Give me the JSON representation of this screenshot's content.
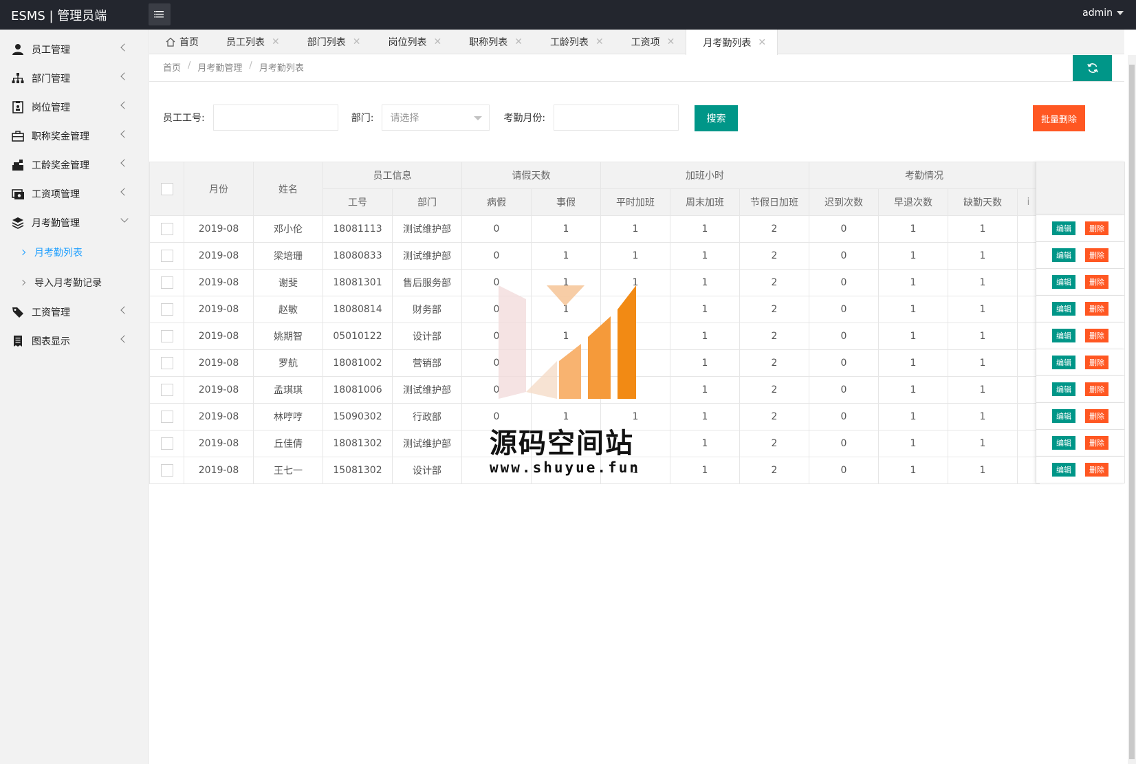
{
  "header": {
    "brand": "ESMS | 管理员端",
    "user": "admin"
  },
  "sidebar": {
    "items": [
      {
        "label": "员工管理",
        "icon": "user-icon"
      },
      {
        "label": "部门管理",
        "icon": "sitemap-icon"
      },
      {
        "label": "岗位管理",
        "icon": "badge-icon"
      },
      {
        "label": "职称奖金管理",
        "icon": "briefcase-icon"
      },
      {
        "label": "工龄奖金管理",
        "icon": "cash-register-icon"
      },
      {
        "label": "工资项管理",
        "icon": "money-icon"
      },
      {
        "label": "月考勤管理",
        "icon": "layers-icon"
      },
      {
        "label": "工资管理",
        "icon": "tag-icon"
      },
      {
        "label": "图表显示",
        "icon": "receipt-icon"
      }
    ],
    "sub_items": [
      {
        "label": "月考勤列表",
        "active": true
      },
      {
        "label": "导入月考勤记录",
        "active": false
      }
    ]
  },
  "tabs": [
    {
      "label": "首页",
      "home": true
    },
    {
      "label": "员工列表"
    },
    {
      "label": "部门列表"
    },
    {
      "label": "岗位列表"
    },
    {
      "label": "职称列表"
    },
    {
      "label": "工龄列表"
    },
    {
      "label": "工资项"
    },
    {
      "label": "月考勤列表",
      "active": true
    }
  ],
  "tab_close": "✕",
  "breadcrumb": [
    "首页",
    "月考勤管理",
    "月考勤列表"
  ],
  "breadcrumb_sep": "/",
  "search": {
    "emp_no_label": "员工工号:",
    "emp_no_value": "",
    "dept_label": "部门:",
    "dept_placeholder": "请选择",
    "month_label": "考勤月份:",
    "month_value": "",
    "search_button": "搜索",
    "batch_delete_button": "批量删除"
  },
  "table": {
    "group_headers": {
      "month": "月份",
      "name": "姓名",
      "emp_info": "员工信息",
      "leave": "请假天数",
      "overtime": "加班小时",
      "attendance": "考勤情况"
    },
    "sub_headers": {
      "emp_no": "工号",
      "dept": "部门",
      "sick": "病假",
      "personal": "事假",
      "weekday_ot": "平时加班",
      "weekend_ot": "周末加班",
      "holiday_ot": "节假日加班",
      "late": "迟到次数",
      "early": "早退次数",
      "absent": "缺勤天数",
      "truncated": "i"
    },
    "rows": [
      {
        "month": "2019-08",
        "name": "邓小伦",
        "emp_no": "18081113",
        "dept": "测试维护部",
        "sick": "0",
        "personal": "1",
        "weekday_ot": "1",
        "weekend_ot": "1",
        "holiday_ot": "2",
        "late": "0",
        "early": "1",
        "absent": "1"
      },
      {
        "month": "2019-08",
        "name": "梁培珊",
        "emp_no": "18080833",
        "dept": "测试维护部",
        "sick": "0",
        "personal": "1",
        "weekday_ot": "1",
        "weekend_ot": "1",
        "holiday_ot": "2",
        "late": "0",
        "early": "1",
        "absent": "1"
      },
      {
        "month": "2019-08",
        "name": "谢斐",
        "emp_no": "18081301",
        "dept": "售后服务部",
        "sick": "0",
        "personal": "1",
        "weekday_ot": "1",
        "weekend_ot": "1",
        "holiday_ot": "2",
        "late": "0",
        "early": "1",
        "absent": "1"
      },
      {
        "month": "2019-08",
        "name": "赵敏",
        "emp_no": "18080814",
        "dept": "财务部",
        "sick": "0",
        "personal": "1",
        "weekday_ot": "",
        "weekend_ot": "1",
        "holiday_ot": "2",
        "late": "0",
        "early": "1",
        "absent": "1"
      },
      {
        "month": "2019-08",
        "name": "姚期智",
        "emp_no": "05010122",
        "dept": "设计部",
        "sick": "0",
        "personal": "1",
        "weekday_ot": "",
        "weekend_ot": "1",
        "holiday_ot": "2",
        "late": "0",
        "early": "1",
        "absent": "1"
      },
      {
        "month": "2019-08",
        "name": "罗航",
        "emp_no": "18081002",
        "dept": "营销部",
        "sick": "0",
        "personal": "",
        "weekday_ot": "",
        "weekend_ot": "1",
        "holiday_ot": "2",
        "late": "0",
        "early": "1",
        "absent": "1"
      },
      {
        "month": "2019-08",
        "name": "孟琪琪",
        "emp_no": "18081006",
        "dept": "测试维护部",
        "sick": "0",
        "personal": "",
        "weekday_ot": "",
        "weekend_ot": "1",
        "holiday_ot": "2",
        "late": "0",
        "early": "1",
        "absent": "1"
      },
      {
        "month": "2019-08",
        "name": "林哼哼",
        "emp_no": "15090302",
        "dept": "行政部",
        "sick": "0",
        "personal": "1",
        "weekday_ot": "1",
        "weekend_ot": "1",
        "holiday_ot": "2",
        "late": "0",
        "early": "1",
        "absent": "1"
      },
      {
        "month": "2019-08",
        "name": "丘佳倩",
        "emp_no": "18081302",
        "dept": "测试维护部",
        "sick": "",
        "personal": "",
        "weekday_ot": "",
        "weekend_ot": "1",
        "holiday_ot": "2",
        "late": "0",
        "early": "1",
        "absent": "1"
      },
      {
        "month": "2019-08",
        "name": "王七一",
        "emp_no": "15081302",
        "dept": "设计部",
        "sick": "",
        "personal": "",
        "weekday_ot": "1",
        "weekend_ot": "1",
        "holiday_ot": "2",
        "late": "0",
        "early": "1",
        "absent": "1"
      }
    ],
    "edit_label": "编辑",
    "delete_label": "删除"
  },
  "watermark": {
    "title": "源码空间站",
    "url": "www.shuyue.fun"
  },
  "colors": {
    "primary": "#009688",
    "danger": "#ff5722",
    "header_bg": "#23262e",
    "active_link": "#1e9fff"
  }
}
